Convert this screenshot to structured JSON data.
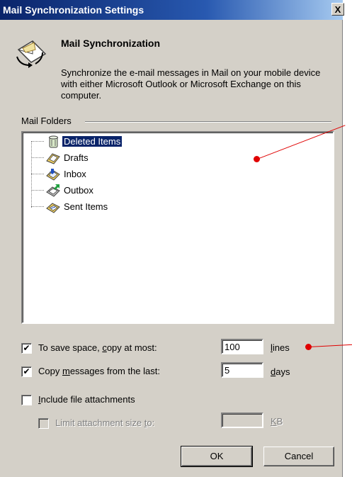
{
  "window": {
    "title": "Mail Synchronization Settings",
    "close_glyph": "X"
  },
  "header": {
    "heading": "Mail Synchronization",
    "description": "Synchronize the e-mail messages in Mail on your mobile device with either Microsoft Outlook or Microsoft Exchange on this computer."
  },
  "folders": {
    "group_label": "Mail Folders",
    "items": [
      {
        "label": "Deleted Items",
        "icon": "deleted-items-icon",
        "selected": true
      },
      {
        "label": "Drafts",
        "icon": "drafts-icon"
      },
      {
        "label": "Inbox",
        "icon": "inbox-icon"
      },
      {
        "label": "Outbox",
        "icon": "outbox-icon"
      },
      {
        "label": "Sent Items",
        "icon": "sent-items-icon"
      }
    ]
  },
  "options": {
    "copy_at_most": {
      "label_pre": "To save space, ",
      "label_key": "c",
      "label_post": "opy at most:",
      "checked": true,
      "value": "100",
      "unit_key": "l",
      "unit_post": "ines"
    },
    "copy_last": {
      "label_pre": "Copy ",
      "label_key": "m",
      "label_post": "essages from the last:",
      "checked": true,
      "value": "5",
      "unit_key": "d",
      "unit_post": "ays"
    },
    "include_attachments": {
      "label_pre": "",
      "label_key": "I",
      "label_post": "nclude file attachments",
      "checked": false
    },
    "limit_attachment": {
      "label_pre": "Limit attachment size ",
      "label_key": "t",
      "label_post": "o:",
      "checked": false,
      "disabled": true,
      "value": "",
      "unit_key": "K",
      "unit_post": "B"
    }
  },
  "buttons": {
    "ok": "OK",
    "cancel": "Cancel"
  },
  "colors": {
    "title_bar": "#0a246a",
    "selection": "#0a246a",
    "face": "#d4d0c8",
    "callout": "#e00000"
  }
}
